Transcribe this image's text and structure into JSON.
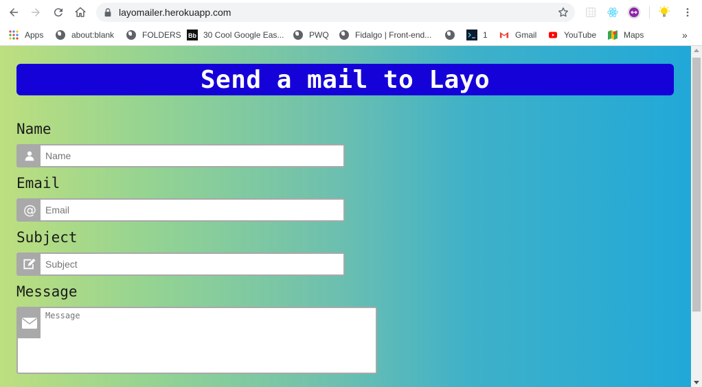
{
  "browser": {
    "url": "layomailer.herokuapp.com",
    "bookmarks": [
      {
        "label": "Apps",
        "icon": "apps-grid-icon"
      },
      {
        "label": "about:blank",
        "icon": "globe-icon"
      },
      {
        "label": "FOLDERS",
        "icon": "globe-icon"
      },
      {
        "label": "30 Cool Google Eas...",
        "icon": "behance-icon"
      },
      {
        "label": "PWQ",
        "icon": "globe-icon"
      },
      {
        "label": "Fidalgo | Front-end...",
        "icon": "globe-icon"
      },
      {
        "label": "",
        "icon": "globe-icon"
      },
      {
        "label": "1",
        "icon": "terminal-icon"
      },
      {
        "label": "Gmail",
        "icon": "gmail-icon"
      },
      {
        "label": "YouTube",
        "icon": "youtube-icon"
      },
      {
        "label": "Maps",
        "icon": "maps-icon"
      }
    ],
    "overflow_label": "»"
  },
  "page": {
    "title": "Send a mail to Layo",
    "fields": {
      "name": {
        "label": "Name",
        "placeholder": "Name",
        "icon": "user-icon"
      },
      "email": {
        "label": "Email",
        "placeholder": "Email",
        "icon": "at-sign-icon"
      },
      "subject": {
        "label": "Subject",
        "placeholder": "Subject",
        "icon": "edit-icon"
      },
      "message": {
        "label": "Message",
        "placeholder": "Message",
        "icon": "envelope-icon"
      }
    }
  },
  "colors": {
    "banner": "#1502d8",
    "gradient_start": "#bddf7f",
    "gradient_end": "#21a8d8",
    "addon": "#a9a9a9"
  }
}
